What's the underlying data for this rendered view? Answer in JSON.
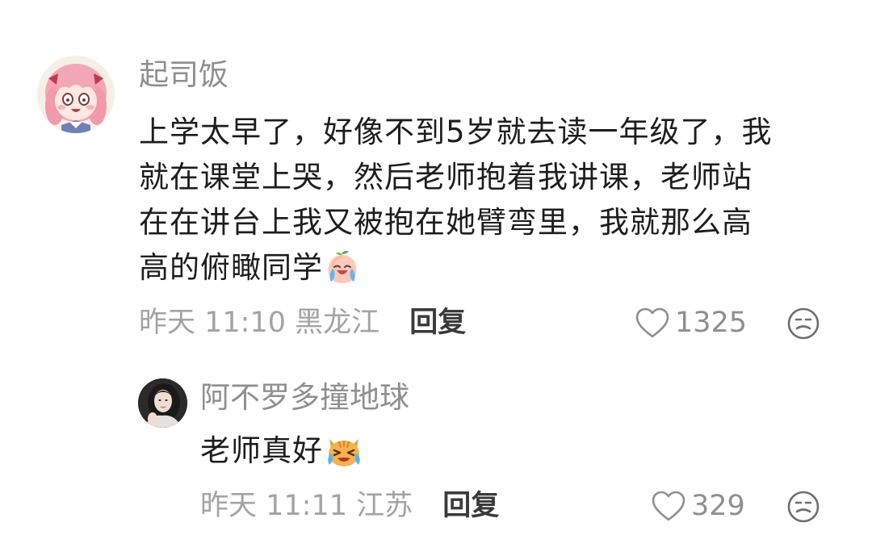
{
  "comment": {
    "username": "起司饭",
    "lines": [
      "上学太早了，好像不到5岁就去读一年级了，我",
      "就在课堂上哭，然后老师抱着我讲课，老师站",
      "在在讲台上我又被抱在她臂弯里，我就那么高",
      "高的俯瞰同学"
    ],
    "emoji": "crying-peach-emoji",
    "time": "昨天 11:10",
    "location": "黑龙江",
    "reply_label": "回复",
    "like_count": "1325",
    "like_icon": "heart-outline-icon",
    "dislike_icon": "unhappy-face-icon"
  },
  "reply": {
    "username": "阿不罗多撞地球",
    "text": "老师真好",
    "emoji": "crying-cat-emoji",
    "time": "昨天 11:11",
    "location": "江苏",
    "reply_label": "回复",
    "like_count": "329",
    "like_icon": "heart-outline-icon",
    "dislike_icon": "unhappy-face-icon"
  },
  "colors": {
    "username": "#8f8f8f",
    "text": "#1d1d1d",
    "meta": "#a3a3a3",
    "reply_link": "#3a3a3a",
    "icon": "#8f8f8f"
  }
}
